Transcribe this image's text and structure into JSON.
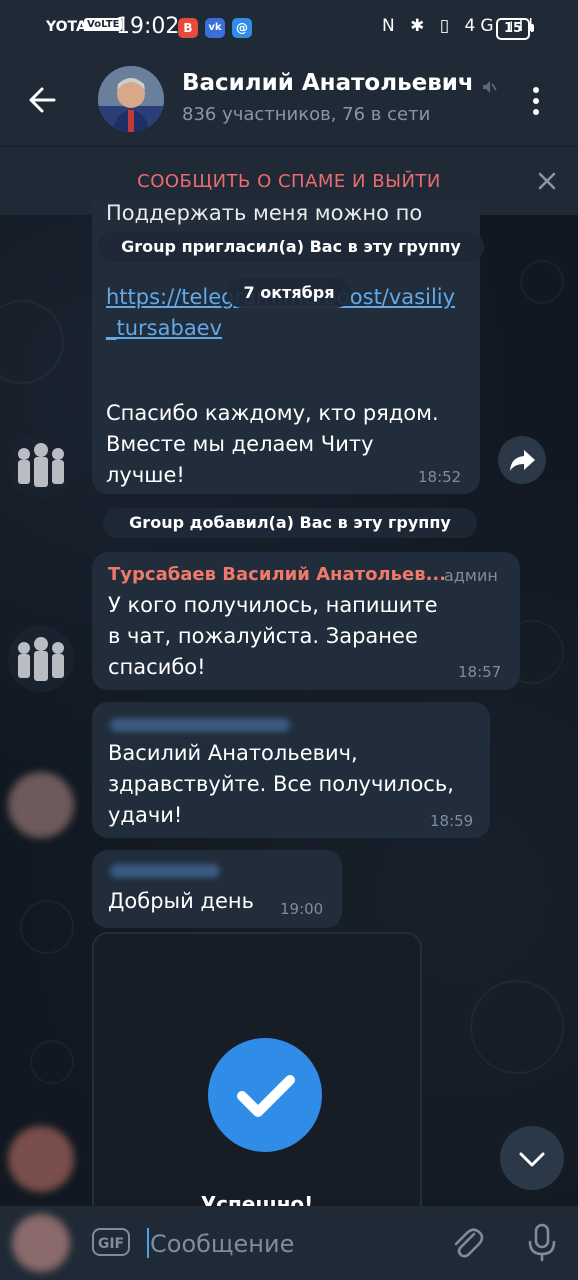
{
  "status_bar": {
    "carrier": "YOTA",
    "volte": "VoLTE",
    "time": "19:02",
    "notif_icons": [
      "B",
      "vk",
      "@"
    ],
    "right_icons": "N ✱ ▯ 4G ıll",
    "battery": "15"
  },
  "header": {
    "title": "Василий Анатольевич",
    "subtitle": "836 участников, 76 в сети"
  },
  "spam_bar": {
    "label": "СООБЩИТЬ О СПАМЕ И ВЫЙТИ"
  },
  "messages": {
    "m1_top_clip": "Поддержать меня можно по",
    "invite_pill": "Group пригласил(а) Вас в эту группу",
    "date_pill": "7 октября",
    "m1_link_1": "https://telegram.me/boost/vasiliy",
    "m1_link_2": "_tursabaev",
    "m1_line1": "Спасибо каждому, кто рядом.",
    "m1_line2": "Вместе мы делаем Читу",
    "m1_line3": "лучше!",
    "m1_time": "18:52",
    "added_pill": "Group добавил(а) Вас в эту группу",
    "m2_sender": "Турсабаев Василий Анатольев...",
    "m2_role": "админ",
    "m2_line1": "У кого получилось, напишите",
    "m2_line2": "в чат, пожалуйста. Заранее",
    "m2_line3": "спасибо!",
    "m2_time": "18:57",
    "m3_line1": "Василий Анатольевич,",
    "m3_line2": "здравствуйте. Все получилось,",
    "m3_line3": "удачи!",
    "m3_time": "18:59",
    "m4_text": "Добрый день",
    "m4_time": "19:00",
    "m5_caption": "Успешно!"
  },
  "input": {
    "placeholder": "Сообщение",
    "gif_label": "GIF"
  },
  "colors": {
    "accent": "#4aa3ee",
    "header_bg": "#1f2a36",
    "bubble_bg": "#212d3b",
    "spam_red": "#ea6b70",
    "sender_name": "#ee7a6a",
    "link": "#63a9e8"
  }
}
